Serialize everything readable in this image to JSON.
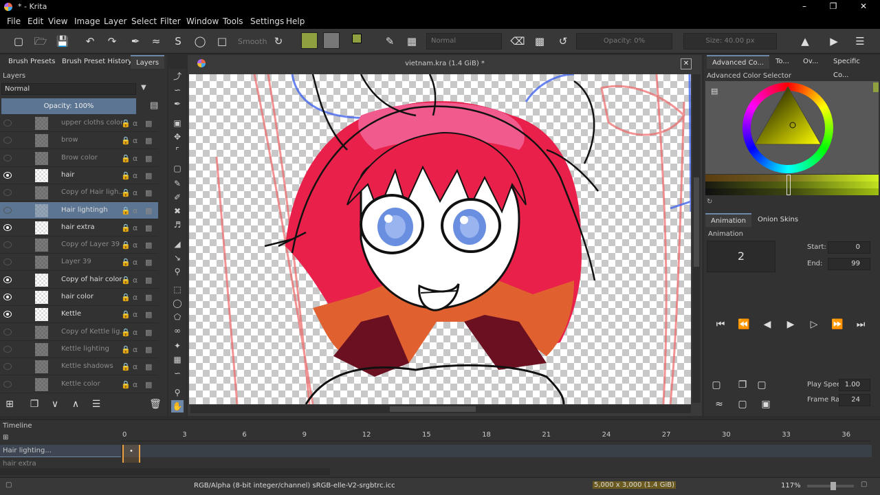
{
  "window": {
    "title": "* - Krita"
  },
  "menu": [
    "File",
    "Edit",
    "View",
    "Image",
    "Layer",
    "Select",
    "Filter",
    "Window",
    "Tools",
    "Settings",
    "Help"
  ],
  "toolbar": {
    "smooth_label": "Smooth",
    "blend_mode": "Normal",
    "opacity": "Opacity: 0%",
    "size": "Size: 40.00 px"
  },
  "left_tabs": [
    "Brush Presets",
    "Brush Preset History",
    "Layers"
  ],
  "layers_panel": {
    "title": "Layers",
    "blend_mode": "Normal",
    "opacity": "Opacity:  100%",
    "layers": [
      {
        "name": "upper cloths color",
        "visible": false
      },
      {
        "name": "brow",
        "visible": false
      },
      {
        "name": "Brow color",
        "visible": false
      },
      {
        "name": "hair",
        "visible": true
      },
      {
        "name": "Copy of Hair ligh...",
        "visible": false
      },
      {
        "name": "Hair lightingh",
        "visible": false,
        "selected": true
      },
      {
        "name": "hair extra",
        "visible": true
      },
      {
        "name": "Copy of Layer 39",
        "visible": false
      },
      {
        "name": "Layer 39",
        "visible": false
      },
      {
        "name": "Copy of hair color",
        "visible": true
      },
      {
        "name": "hair color",
        "visible": true
      },
      {
        "name": "Kettle",
        "visible": true
      },
      {
        "name": "Copy of Kettle lig...",
        "visible": false
      },
      {
        "name": "Kettle lighting",
        "visible": false
      },
      {
        "name": "Kettle shadows",
        "visible": false
      },
      {
        "name": "Kettle color",
        "visible": false
      }
    ]
  },
  "canvas": {
    "doc_title": "vietnam.kra (1.4 GiB) *"
  },
  "right_tabs": [
    "Advanced Co...",
    "To...",
    "Ov...",
    "Specific Co..."
  ],
  "color_selector": {
    "title": "Advanced Color Selector"
  },
  "animation": {
    "tabs": [
      "Animation",
      "Onion Skins"
    ],
    "title": "Animation",
    "current_frame": "2",
    "start_label": "Start:",
    "start_value": "0",
    "end_label": "End:",
    "end_value": "99",
    "play_speed_label": "Play Speed:",
    "play_speed_value": "1.00",
    "frame_rate_label": "Frame Rate:",
    "frame_rate_value": "24"
  },
  "timeline": {
    "title": "Timeline",
    "ruler": [
      "0",
      "3",
      "6",
      "9",
      "12",
      "15",
      "18",
      "21",
      "24",
      "27",
      "30",
      "33",
      "36"
    ],
    "layers": [
      "Hair lighting...",
      "hair extra"
    ]
  },
  "status": {
    "color_space": "RGB/Alpha (8-bit integer/channel)  sRGB-elle-V2-srgbtrc.icc",
    "dimensions": "5,000 x 3,000 (1.4 GiB)",
    "zoom": "117%"
  },
  "colors": {
    "accent": "#6d88a8",
    "selected_layer": "#5b7592",
    "fg_color": "#8ea040",
    "frame_marker": "#e8a040"
  }
}
